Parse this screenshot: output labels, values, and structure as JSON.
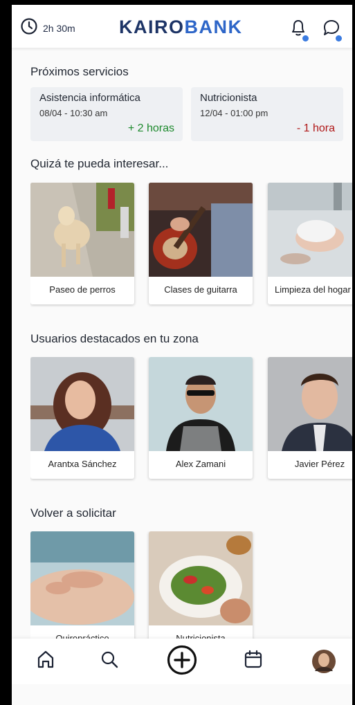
{
  "header": {
    "timer": "2h 30m",
    "logo_part1": "KAIRO",
    "logo_part2": "BANK",
    "icons": [
      "clock-icon",
      "bell-icon",
      "chat-icon"
    ]
  },
  "upcoming": {
    "title": "Próximos servicios",
    "items": [
      {
        "name": "Asistencia informática",
        "date": "08/04 - 10:30 am",
        "delta": "+ 2 horas",
        "delta_color": "#1e8a2e"
      },
      {
        "name": "Nutricionista",
        "date": "12/04 - 01:00 pm",
        "delta": "- 1 hora",
        "delta_color": "#b01818"
      }
    ]
  },
  "interest": {
    "title": "Quizá te pueda interesar...",
    "items": [
      {
        "label": "Paseo de perros"
      },
      {
        "label": "Clases de guitarra"
      },
      {
        "label": "Limpieza del hogar"
      }
    ]
  },
  "featured": {
    "title": "Usuarios destacados en tu zona",
    "items": [
      {
        "label": "Arantxa Sánchez"
      },
      {
        "label": "Alex Zamani"
      },
      {
        "label": "Javier Pérez"
      }
    ]
  },
  "again": {
    "title": "Volver a solicitar",
    "items": [
      {
        "label": "Quiropráctico"
      },
      {
        "label": "Nutricionista"
      }
    ]
  },
  "nav": {
    "icons": [
      "home-icon",
      "search-icon",
      "add-circle-icon",
      "calendar-icon",
      "profile-avatar"
    ]
  },
  "colors": {
    "brand_dark": "#1d3466",
    "brand_accent": "#2e66c8",
    "positive": "#1e8a2e",
    "negative": "#b01818"
  }
}
